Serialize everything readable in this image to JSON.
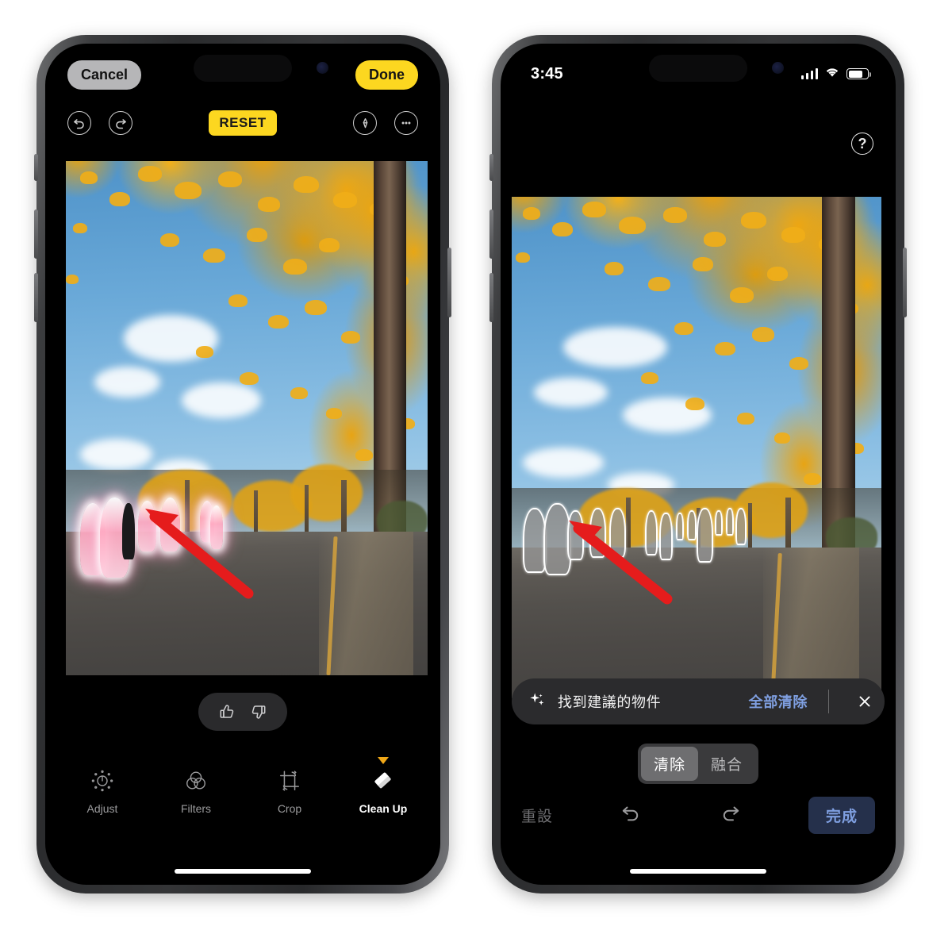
{
  "left_phone": {
    "name": "photos-edit-screen",
    "top_bar": {
      "cancel_label": "Cancel",
      "done_label": "Done"
    },
    "tool_bar": {
      "undo_icon": "undo-arrow-icon",
      "redo_icon": "redo-arrow-icon",
      "reset_label": "RESET",
      "markup_icon": "markup-pen-icon",
      "more_icon": "more-ellipsis-icon"
    },
    "feedback": {
      "thumbs_up_icon": "thumbs-up-icon",
      "thumbs_down_icon": "thumbs-down-icon"
    },
    "tools": [
      {
        "label": "Adjust",
        "icon": "adjust-dial-icon",
        "active": false
      },
      {
        "label": "Filters",
        "icon": "filters-circles-icon",
        "active": false
      },
      {
        "label": "Crop",
        "icon": "crop-rotate-icon",
        "active": false
      },
      {
        "label": "Clean Up",
        "icon": "clean-up-eraser-icon",
        "active": true
      }
    ],
    "annotation": {
      "arrow_color": "#e51c1c"
    },
    "colors": {
      "done_button": "#fcd720",
      "reset_chip": "#fcd720",
      "cancel_button": "#b6b6b8",
      "highlight_glow": "#ffaac3"
    }
  },
  "right_phone": {
    "name": "photos-cleanup-screen",
    "status_bar": {
      "time": "3:45",
      "cellular_icon": "signal-bars-icon",
      "wifi_icon": "wifi-icon",
      "battery_icon": "battery-icon"
    },
    "help_button": {
      "label": "?",
      "icon": "help-question-icon"
    },
    "suggestion_banner": {
      "sparkle_icon": "sparkles-icon",
      "text": "找到建議的物件",
      "action_label": "全部清除",
      "close_icon": "close-x-icon"
    },
    "segmented_control": {
      "options": [
        {
          "label": "清除",
          "selected": true
        },
        {
          "label": "融合",
          "selected": false
        }
      ]
    },
    "bottom_bar": {
      "reset_label": "重設",
      "undo_icon": "undo-arrow-icon",
      "redo_icon": "redo-arrow-icon",
      "done_label": "完成"
    },
    "annotation": {
      "arrow_color": "#e51c1c"
    },
    "colors": {
      "accent_blue": "#7f9fe0",
      "done_button_bg": "#25304b",
      "selection_outline": "#ffffff"
    }
  },
  "photo": {
    "description": "ginkgo-tree-avenue-autumn",
    "subjects": "pedestrians-on-park-path"
  }
}
